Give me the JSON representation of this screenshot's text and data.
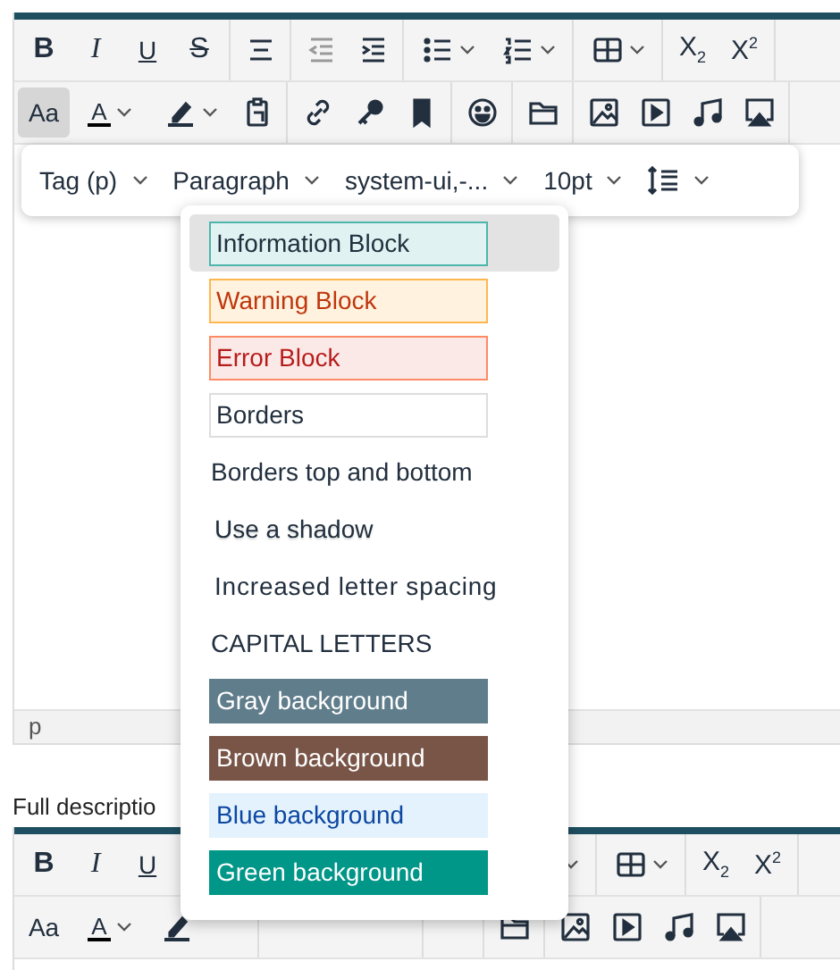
{
  "editors": [
    {
      "toolbar_rows": [
        [
          [
            {
              "kind": "bold",
              "text": "B",
              "selected": false
            },
            {
              "kind": "italic",
              "text": "I",
              "selected": false
            },
            {
              "kind": "underline",
              "text": "U",
              "selected": false
            },
            {
              "kind": "strike",
              "text": "S",
              "selected": false
            }
          ],
          [
            {
              "kind": "align-center",
              "selected": false
            }
          ],
          [
            {
              "kind": "outdent",
              "selected": false
            },
            {
              "kind": "indent",
              "selected": false
            }
          ],
          [
            {
              "kind": "bullet-list",
              "caret": true,
              "selected": false
            },
            {
              "kind": "numbered-list",
              "caret": true,
              "selected": false
            }
          ],
          [
            {
              "kind": "table",
              "caret": true,
              "selected": false
            }
          ],
          [
            {
              "kind": "subscript",
              "text": "X$_{2}$",
              "selected": false
            },
            {
              "kind": "superscript",
              "text": "X$^{2}$",
              "selected": false
            }
          ]
        ],
        [
          [
            {
              "kind": "case",
              "text": "Aa",
              "selected": true
            },
            {
              "kind": "text-color",
              "text": "A",
              "caret": true,
              "selected": false
            },
            {
              "kind": "highlight",
              "caret": true,
              "selected": false
            },
            {
              "kind": "paste",
              "selected": false
            }
          ],
          [
            {
              "kind": "link",
              "selected": false
            },
            {
              "kind": "key",
              "selected": false
            },
            {
              "kind": "bookmark",
              "selected": false
            }
          ],
          [
            {
              "kind": "emoji",
              "selected": false
            }
          ],
          [
            {
              "kind": "folder",
              "selected": false
            }
          ],
          [
            {
              "kind": "image",
              "selected": false
            },
            {
              "kind": "video",
              "selected": false
            },
            {
              "kind": "audio",
              "selected": false
            },
            {
              "kind": "cast",
              "selected": false
            }
          ]
        ]
      ],
      "status": "p"
    },
    {
      "label": "Full descriptio",
      "toolbar_rows": [
        [
          [
            {
              "kind": "bold",
              "text": "B",
              "selected": false
            },
            {
              "kind": "italic",
              "text": "I",
              "selected": false
            },
            {
              "kind": "underline",
              "text": "U",
              "selected": false
            },
            {
              "kind": "covered"
            }
          ],
          [
            {
              "kind": "covered"
            }
          ],
          [
            {
              "kind": "covered"
            },
            {
              "kind": "covered"
            }
          ],
          [
            {
              "kind": "covered"
            },
            {
              "kind": "covered"
            },
            {
              "kind": "covered"
            },
            {
              "kind": "caret"
            }
          ],
          [
            {
              "kind": "table",
              "caret": true,
              "selected": false
            }
          ],
          [
            {
              "kind": "subscript",
              "text": "X$_{2}$",
              "selected": false
            },
            {
              "kind": "superscript",
              "text": "X$^{2}$",
              "selected": false
            }
          ]
        ],
        [
          [
            {
              "kind": "case",
              "text": "Aa",
              "selected": false
            },
            {
              "kind": "text-color",
              "text": "A",
              "caret": true,
              "selected": false
            },
            {
              "kind": "highlight",
              "selected": false
            },
            {
              "kind": "covered"
            }
          ],
          [
            {
              "kind": "covered"
            },
            {
              "kind": "covered"
            },
            {
              "kind": "covered"
            }
          ],
          [
            {
              "kind": "covered"
            }
          ],
          [
            {
              "kind": "folder",
              "selected": false
            }
          ],
          [
            {
              "kind": "image",
              "selected": false
            },
            {
              "kind": "video",
              "selected": false
            },
            {
              "kind": "audio",
              "selected": false
            },
            {
              "kind": "cast",
              "selected": false
            }
          ]
        ]
      ]
    }
  ],
  "format_toolbar": [
    {
      "text": "Tag (p)"
    },
    {
      "text": "Paragraph"
    },
    {
      "text": "system-ui,-..."
    },
    {
      "text": "10pt"
    },
    {
      "kind": "line-height"
    }
  ],
  "styles_menu": [
    {
      "text": "Information Block",
      "kind": "info",
      "selected": true
    },
    {
      "text": "Warning Block",
      "kind": "warning",
      "selected": false
    },
    {
      "text": "Error Block",
      "kind": "error",
      "selected": false
    },
    {
      "text": "Borders",
      "kind": "borders",
      "selected": false
    },
    {
      "text": "Borders top and bottom",
      "kind": "plain",
      "selected": false
    },
    {
      "text": "Use a shadow",
      "kind": "shadow",
      "selected": false
    },
    {
      "text": "Increased letter spacing",
      "kind": "spaced",
      "selected": false
    },
    {
      "text": "CAPITAL LETTERS",
      "kind": "plain",
      "selected": false
    },
    {
      "text": "Gray background",
      "kind": "gray",
      "selected": false
    },
    {
      "text": "Brown background",
      "kind": "brown",
      "selected": false
    },
    {
      "text": "Blue background",
      "kind": "blue",
      "selected": false
    },
    {
      "text": "Green background",
      "kind": "green",
      "selected": false
    }
  ]
}
